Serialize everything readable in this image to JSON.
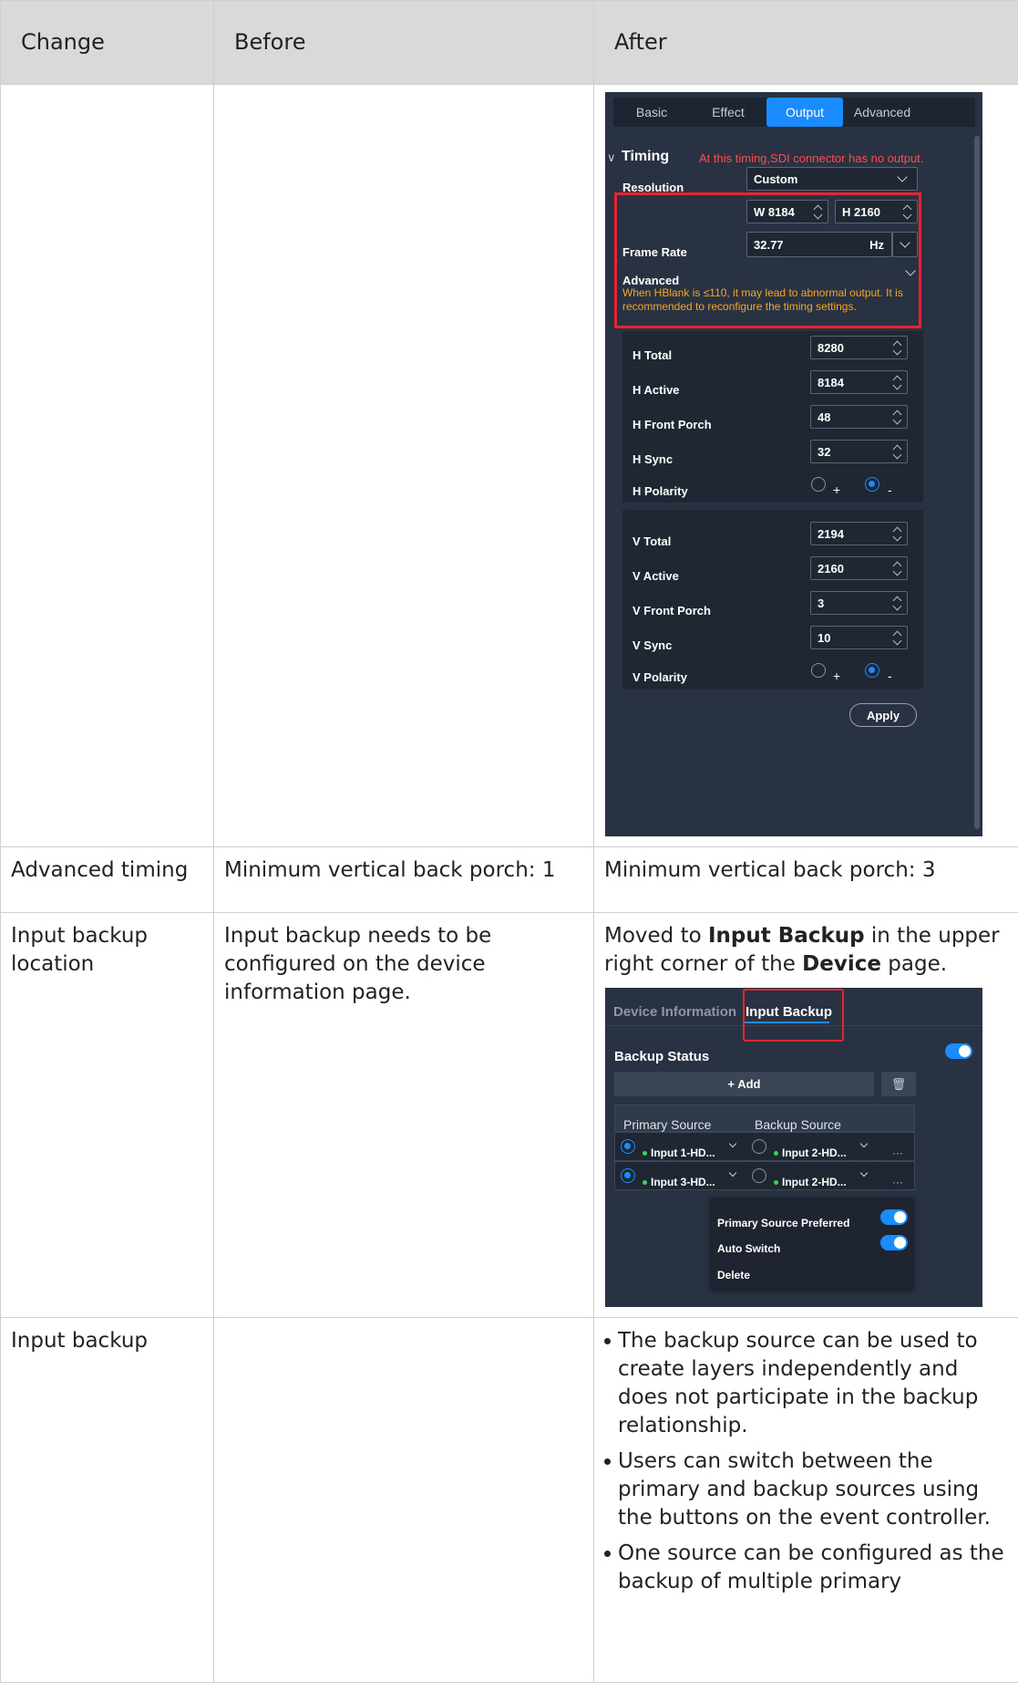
{
  "table": {
    "headers": [
      "Change",
      "Before",
      "After"
    ],
    "rows": [
      {
        "change": "",
        "before": "",
        "after": ""
      },
      {
        "change": "Advanced timing",
        "before": "Minimum vertical back porch: 1",
        "after": "Minimum vertical back porch: 3"
      },
      {
        "change": "Input backup location",
        "before": "Input backup needs to be configured on the device information page.",
        "after_prefix": "Moved to ",
        "after_bold1": "Input Backup",
        "after_mid": " in the upper right corner of the ",
        "after_bold2": "Device",
        "after_suffix": " page."
      },
      {
        "change": "Input backup",
        "before": "",
        "bullets": [
          "The backup source can be used to create layers independently and does not participate in the backup relationship.",
          "Users can switch between the primary and backup sources using the buttons on the event controller.",
          "One source can be configured as the backup of multiple primary"
        ]
      }
    ]
  },
  "timing_panel": {
    "tabs": [
      "Basic",
      "Effect",
      "Output",
      "Advanced"
    ],
    "active_tab": "Output",
    "section_title": "Timing",
    "warning_top": "At this timing,SDI connector has no output.",
    "resolution_label": "Resolution",
    "resolution_value": "Custom",
    "width_value": "W 8184",
    "height_value": "H  2160",
    "frame_rate_label": "Frame Rate",
    "frame_rate_value": "32.77",
    "frame_rate_unit": "Hz",
    "advanced_label": "Advanced",
    "hblank_warning": "When HBlank is ≤110, it may lead to abnormal output. It is recommended to reconfigure the timing settings.",
    "h_fields": [
      {
        "label": "H Total",
        "value": "8280"
      },
      {
        "label": "H Active",
        "value": "8184"
      },
      {
        "label": "H Front Porch",
        "value": "48"
      },
      {
        "label": "H Sync",
        "value": "32"
      }
    ],
    "h_polarity_label": "H Polarity",
    "v_fields": [
      {
        "label": "V Total",
        "value": "2194"
      },
      {
        "label": "V Active",
        "value": "2160"
      },
      {
        "label": "V Front Porch",
        "value": "3"
      },
      {
        "label": "V Sync",
        "value": "10"
      }
    ],
    "v_polarity_label": "V Polarity",
    "polarity_plus": "+",
    "polarity_minus": "-",
    "apply_label": "Apply",
    "colors": {
      "panel": "#283242",
      "accent": "#1a8cff",
      "warning_red": "#ff4d4f",
      "warning_orange": "#f5a623",
      "highlight": "#e5262e"
    }
  },
  "backup_panel": {
    "tabs": [
      "Device Information",
      "Input Backup"
    ],
    "active_tab": "Input Backup",
    "status_label": "Backup Status",
    "add_label": "+ Add",
    "col_primary": "Primary Source",
    "col_backup": "Backup Source",
    "rows": [
      {
        "primary": "Input 1-HD...",
        "backup": "Input 2-HD..."
      },
      {
        "primary": "Input 3-HD...",
        "backup": "Input 2-HD..."
      }
    ],
    "more_label": "···",
    "menu": {
      "preferred": "Primary Source Preferred",
      "auto_switch": "Auto Switch",
      "delete": "Delete"
    }
  }
}
